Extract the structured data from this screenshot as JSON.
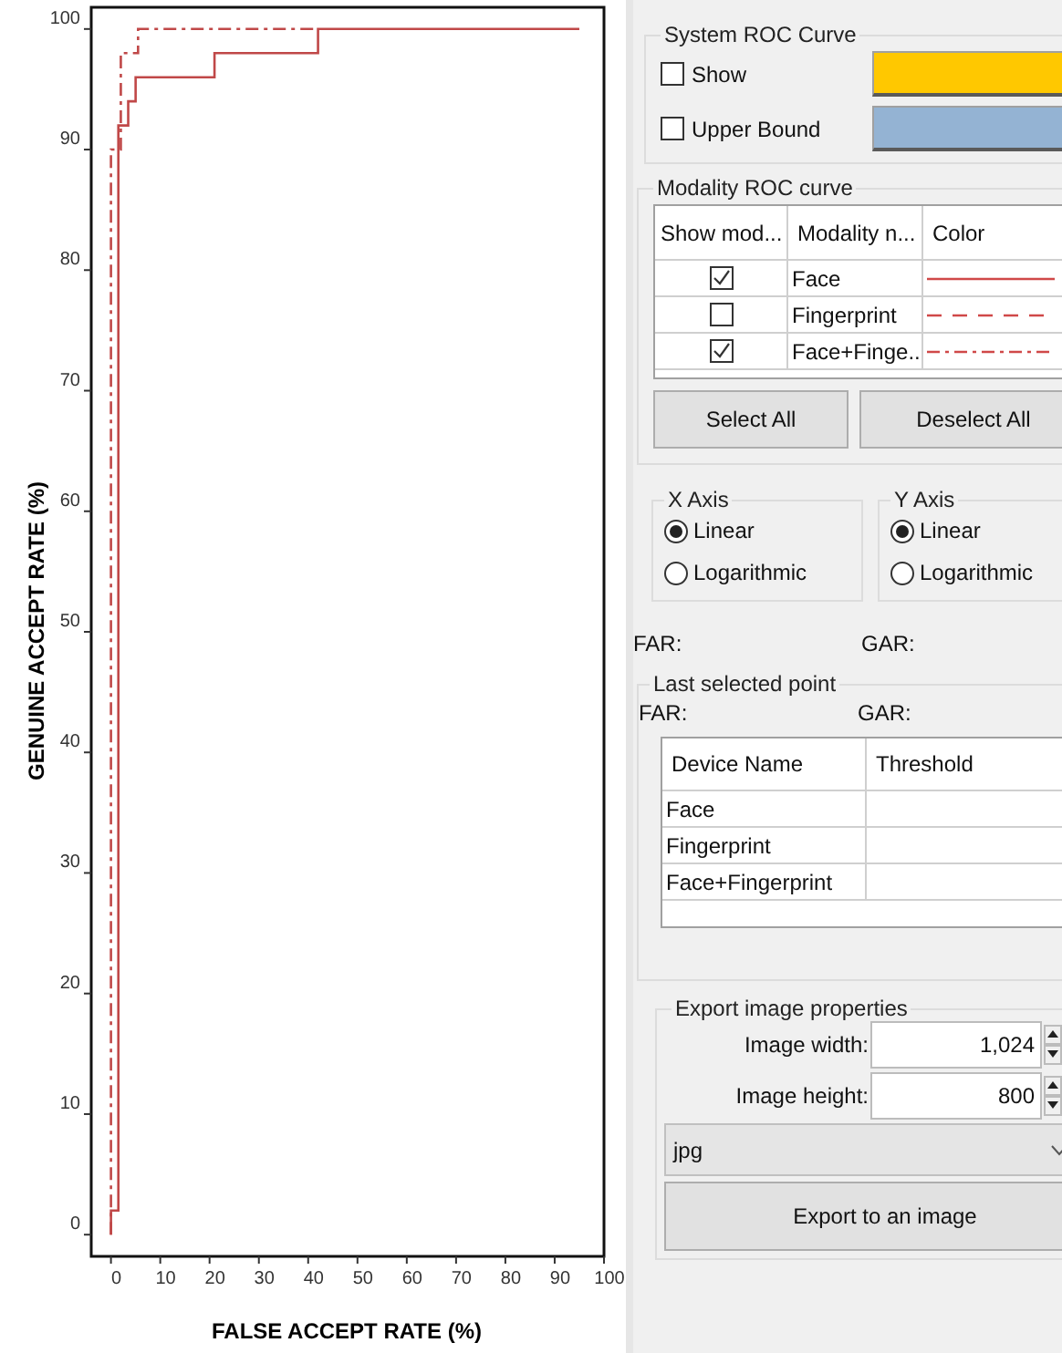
{
  "chart": {
    "chart_data": {
      "type": "line",
      "xlabel": "FALSE ACCEPT RATE (%)",
      "ylabel": "GENUINE ACCEPT RATE (%)",
      "xlim": [
        -4,
        100
      ],
      "ylim": [
        -1.8,
        101.8
      ],
      "xticks": [
        0,
        10,
        20,
        30,
        40,
        50,
        60,
        70,
        80,
        90,
        100
      ],
      "yticks": [
        0,
        10,
        20,
        30,
        40,
        50,
        60,
        70,
        80,
        90,
        100
      ],
      "series": [
        {
          "color": "#c04848",
          "line_style": "solid",
          "x": [
            0,
            0,
            1.5,
            1.5,
            3.5,
            3.5,
            5,
            5,
            21,
            21,
            42,
            42,
            95
          ],
          "values": [
            0,
            2,
            2,
            92,
            92,
            94,
            94,
            96,
            96,
            98,
            98,
            100,
            100
          ]
        },
        {
          "color": "#c04848",
          "line_style": "dashdot",
          "x": [
            0,
            0,
            2,
            2,
            5.5,
            5.5,
            42
          ],
          "values": [
            0,
            90,
            90,
            98,
            98,
            100,
            100
          ]
        }
      ]
    }
  },
  "system_roc_curve": {
    "title": "System ROC Curve",
    "options": [
      {
        "label": "Show",
        "checked": false,
        "color": "#ffc800"
      },
      {
        "label": "Upper Bound",
        "checked": false,
        "color": "#94b3d3"
      }
    ]
  },
  "modality_roc_curve": {
    "title": "Modality ROC curve",
    "columns": [
      "Show mod...",
      "Modality n...",
      "Color"
    ],
    "rows": [
      {
        "checked": true,
        "name": "Face",
        "kind": "solid"
      },
      {
        "checked": false,
        "name": "Fingerprint",
        "kind": "dashed"
      },
      {
        "checked": true,
        "name": "Face+Finge...",
        "kind": "dashdot"
      }
    ],
    "buttons": [
      "Select All",
      "Deselect All"
    ]
  },
  "x_axis": {
    "title": "X Axis",
    "options": [
      {
        "label": "Linear",
        "selected": true
      },
      {
        "label": "Logarithmic",
        "selected": false
      }
    ]
  },
  "y_axis": {
    "title": "Y Axis",
    "options": [
      {
        "label": "Linear",
        "selected": true
      },
      {
        "label": "Logarithmic",
        "selected": false
      }
    ]
  },
  "cursor_readout": {
    "far": "FAR:",
    "gar": "GAR:"
  },
  "last_selected_point": {
    "title": "Last selected point",
    "far": "FAR:",
    "gar": "GAR:",
    "columns": [
      "Device Name",
      "Threshold"
    ],
    "rows": [
      {
        "device_name": "Face"
      },
      {
        "device_name": "Fingerprint"
      },
      {
        "device_name": "Face+Fingerprint"
      }
    ]
  },
  "export_image_properties": {
    "title": "Export image properties",
    "fields": [
      {
        "label": "Image width:",
        "value": "1,024"
      },
      {
        "label": "Image height:",
        "value": "800"
      }
    ],
    "format": "jpg",
    "button": "Export to an image"
  }
}
